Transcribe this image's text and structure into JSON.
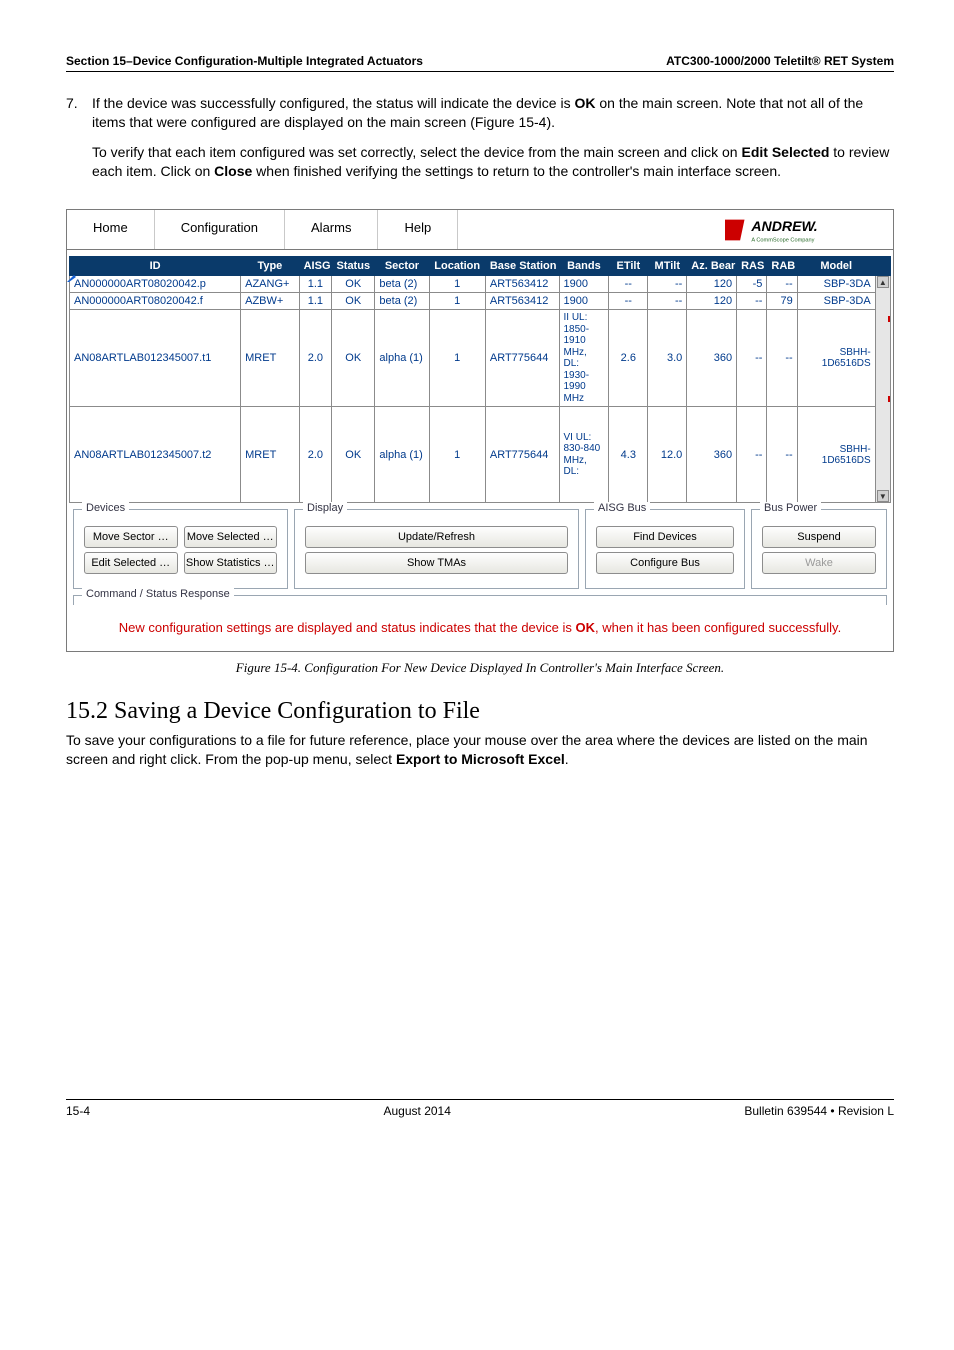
{
  "header": {
    "left": "Section 15–Device Configuration-Multiple Integrated Actuators",
    "right": "ATC300-1000/2000 Teletilt® RET System"
  },
  "step": {
    "number": "7.",
    "para1_pre": "If the device was successfully configured, the status will indicate the device is ",
    "para1_bold": "OK",
    "para1_post": " on the main screen. Note that not all of the items that were configured are displayed on the main screen (Figure 15-4).",
    "para2_a": "To verify that each item configured was set correctly, select the device from the main screen and click on ",
    "para2_b": "Edit Selected",
    "para2_c": " to review each item. Click on ",
    "para2_d": "Close",
    "para2_e": " when finished verifying the settings to return to the controller's main interface screen."
  },
  "app": {
    "menu": {
      "home": "Home",
      "config": "Configuration",
      "alarms": "Alarms",
      "help": "Help"
    },
    "brand": {
      "name": "ANDREW.",
      "sub": "A CommScope Company"
    },
    "cols": {
      "id": "ID",
      "type": "Type",
      "aisg": "AISG",
      "status": "Status",
      "sector": "Sector",
      "location": "Location",
      "base": "Base Station ID",
      "bands": "Bands",
      "etilt": "ETilt",
      "mtilt": "MTilt",
      "bearing": "Az. Bearing",
      "ras": "RAS",
      "rab": "RAB",
      "model": "Model"
    },
    "rows": [
      {
        "id": "AN000000ART08020042.p",
        "type": "AZANG+",
        "aisg": "1.1",
        "status": "OK",
        "sector": "beta (2)",
        "loc": "1",
        "base": "ART563412",
        "bands": "1900",
        "et": "--",
        "mt": "--",
        "bear": "120",
        "ras": "-5",
        "rab": "--",
        "model": "SBP-3DA"
      },
      {
        "id": "AN000000ART08020042.f",
        "type": "AZBW+",
        "aisg": "1.1",
        "status": "OK",
        "sector": "beta (2)",
        "loc": "1",
        "base": "ART563412",
        "bands": "1900",
        "et": "--",
        "mt": "--",
        "bear": "120",
        "ras": "--",
        "rab": "79",
        "model": "SBP-3DA"
      },
      {
        "id": "AN08ARTLAB012345007.t1",
        "type": "MRET",
        "aisg": "2.0",
        "status": "OK",
        "sector": "alpha (1)",
        "loc": "1",
        "base": "ART775644",
        "bands": "II UL: 1850-1910 MHz, DL: 1930-1990 MHz",
        "et": "2.6",
        "mt": "3.0",
        "bear": "360",
        "ras": "--",
        "rab": "--",
        "model": "SBHH-1D6516DS"
      },
      {
        "id": "AN08ARTLAB012345007.t2",
        "type": "MRET",
        "aisg": "2.0",
        "status": "OK",
        "sector": "alpha (1)",
        "loc": "1",
        "base": "ART775644",
        "bands": "VI UL: 830-840 MHz, DL:",
        "et": "4.3",
        "mt": "12.0",
        "bear": "360",
        "ras": "--",
        "rab": "--",
        "model": "SBHH-1D6516DS"
      }
    ],
    "panels": {
      "devices": {
        "legend": "Devices",
        "move_sector": "Move Sector …",
        "move_selected": "Move Selected …",
        "edit_selected": "Edit Selected …",
        "show_stats": "Show Statistics …"
      },
      "display": {
        "legend": "Display",
        "update": "Update/Refresh",
        "show_tmas": "Show TMAs"
      },
      "aisg": {
        "legend": "AISG Bus",
        "find": "Find Devices",
        "configure": "Configure Bus"
      },
      "bus": {
        "legend": "Bus Power",
        "suspend": "Suspend",
        "wake": "Wake"
      }
    },
    "cmd_legend": "Command / Status Response",
    "status_msg_a": "New configuration settings are displayed and status indicates that the device is ",
    "status_msg_b": "OK",
    "status_msg_c": ", when it has been configured successfully."
  },
  "figure_caption": "Figure 15-4.  Configuration For New Device Displayed In Controller's Main Interface Screen.",
  "section": {
    "title": "15.2 Saving a Device Configuration to File",
    "body_a": "To save your configurations to a file for future reference, place your mouse over the area where the devices are listed on the main screen and right click. From the pop-up menu, select ",
    "body_b": "Export to Microsoft Excel",
    "body_c": "."
  },
  "footer": {
    "left": "15-4",
    "center": "August 2014",
    "right": "Bulletin 639544  •  Revision L"
  }
}
